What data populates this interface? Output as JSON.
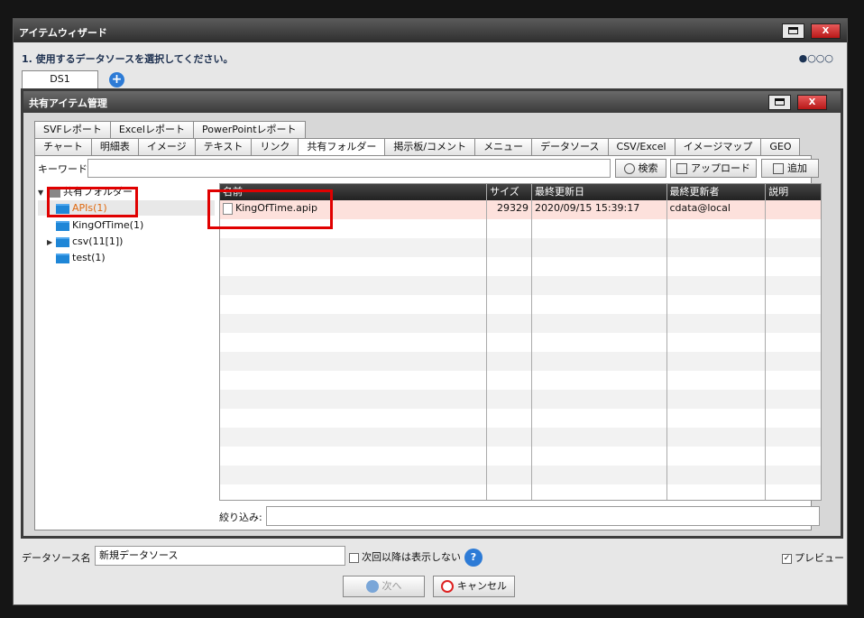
{
  "window": {
    "title": "アイテムウィザード",
    "max_label": "",
    "close_label": "X"
  },
  "step": {
    "text": "1. 使用するデータソースを選択してください。",
    "progress": "●○○○"
  },
  "ds_tab": {
    "label": "DS1",
    "add": "+"
  },
  "inner": {
    "title": "共有アイテム管理",
    "close_label": "X"
  },
  "tabs_row1": [
    "SVFレポート",
    "Excelレポート",
    "PowerPointレポート"
  ],
  "tabs_row2": [
    "チャート",
    "明細表",
    "イメージ",
    "テキスト",
    "リンク",
    "共有フォルダー",
    "掲示板/コメント",
    "メニュー",
    "データソース",
    "CSV/Excel",
    "イメージマップ",
    "GEO"
  ],
  "active_tab": "共有フォルダー",
  "search": {
    "label": "キーワード:",
    "value": "",
    "search_btn": "検索",
    "upload_btn": "アップロード",
    "add_btn": "追加"
  },
  "tree": {
    "root": "共有フォルダー",
    "items": [
      {
        "label": "APIs(1)",
        "selected": true
      },
      {
        "label": "KingOfTime(1)"
      },
      {
        "label": "csv(11[1])",
        "expandable": true
      },
      {
        "label": "test(1)"
      }
    ]
  },
  "grid": {
    "columns": [
      "名前",
      "サイズ",
      "最終更新日",
      "最終更新者",
      "説明"
    ],
    "rows": [
      {
        "name": "KingOfTime.apip",
        "size": "29329",
        "date": "2020/09/15 15:39:17",
        "user": "cdata@local",
        "desc": ""
      }
    ]
  },
  "filter": {
    "label": "絞り込み:",
    "value": ""
  },
  "footer": {
    "ds_label": "データソース名",
    "ds_value": "新規データソース",
    "no_show": "次回以降は表示しない",
    "help": "?",
    "preview": "プレビュー",
    "next": "次へ",
    "cancel": "キャンセル"
  },
  "colors": {
    "accent": "#2d7bd6",
    "highlight": "#e00000",
    "selected_row": "#fde1dc"
  }
}
